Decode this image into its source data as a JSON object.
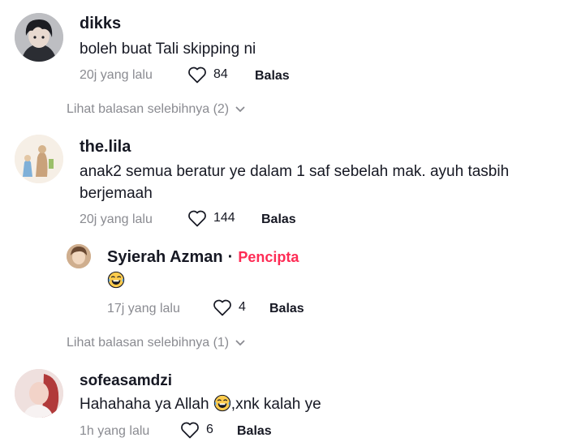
{
  "comments": [
    {
      "username": "dikks",
      "text": "boleh buat Tali skipping ni",
      "time": "20j yang lalu",
      "likes": "84",
      "reply_label": "Balas",
      "more_replies": "Lihat balasan selebihnya (2)"
    },
    {
      "username": "the.lila",
      "text_line1": "anak2 semua beratur ye dalam 1 saf sebelah mak. ayuh tasbih",
      "text_line2": "berjemaah",
      "time": "20j yang lalu",
      "likes": "144",
      "reply_label": "Balas",
      "reply": {
        "username": "Syierah Azman",
        "separator": "·",
        "badge": "Pencipta",
        "emoji": "laughing-tears-emoji",
        "time": "17j yang lalu",
        "likes": "4",
        "reply_label": "Balas"
      },
      "more_replies": "Lihat balasan selebihnya (1)"
    },
    {
      "username": "sofeasamdzi",
      "text_before": "Hahahaha ya Allah ",
      "emoji": "laughing-tears-emoji",
      "text_after": ",xnk kalah ye",
      "time": "1h yang lalu",
      "likes": "6",
      "reply_label": "Balas"
    }
  ],
  "colors": {
    "text": "#161823",
    "muted": "#8a8b91",
    "creator_badge": "#fe2c55"
  },
  "icons": [
    "heart-outline-icon",
    "chevron-down-icon",
    "laughing-tears-emoji"
  ]
}
